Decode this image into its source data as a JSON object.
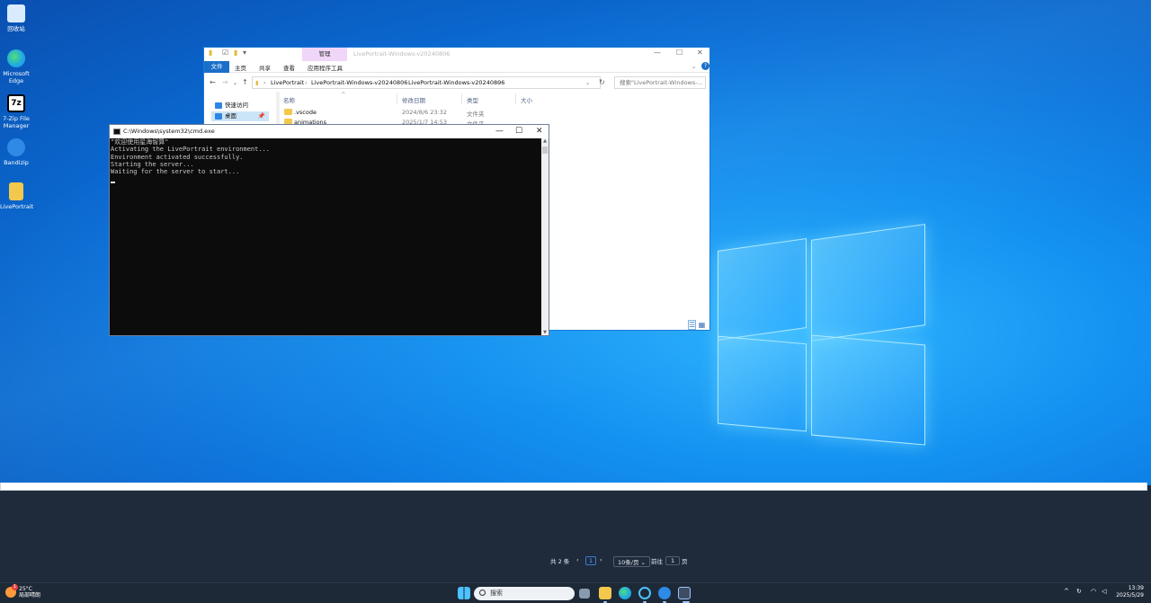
{
  "desktop": {
    "icons": [
      {
        "label": "回收站",
        "color": "#d9ecff"
      },
      {
        "label": "Microsoft Edge",
        "color": "#1fa6e6"
      },
      {
        "label": "7-Zip File Manager",
        "color": "#ffffff"
      },
      {
        "label": "Bandizip",
        "color": "#2e8ae6"
      },
      {
        "label": "LivePortrait",
        "color": "#f2c94c"
      }
    ]
  },
  "explorer": {
    "title": "LivePortrait-Windows-v20240806",
    "context_tab": "管理",
    "ribbon": {
      "file": "文件",
      "home": "主页",
      "share": "共享",
      "view": "查看",
      "app_tools": "应用程序工具"
    },
    "breadcrumb": [
      "LivePortrait",
      "LivePortrait-Windows-v20240806",
      "LivePortrait-Windows-v20240806"
    ],
    "search_placeholder": "搜索\"LivePortrait-Windows-...",
    "sidebar": [
      {
        "label": "快速访问"
      },
      {
        "label": "桌面"
      }
    ],
    "columns": {
      "name": "名称",
      "modified": "修改日期",
      "type": "类型",
      "size": "大小"
    },
    "rows": [
      {
        "name": ".vscode",
        "modified": "2024/8/6 23:32",
        "type": "文件夹"
      },
      {
        "name": "animations",
        "modified": "2025/1/7 14:53",
        "type": "文件夹"
      }
    ]
  },
  "cmd": {
    "title": "C:\\Windows\\system32\\cmd.exe",
    "lines": [
      "\"欢迎使用星海智算\"",
      "Activating the LivePortrait environment...",
      "Environment activated successfully.",
      "Starting the server...",
      "Waiting for the server to start..."
    ]
  },
  "pager": {
    "total": "共 2 条",
    "prev": "‹",
    "current": "1",
    "next": "›",
    "page_size": "10条/页",
    "goto_label": "前往",
    "goto_value": "1",
    "page_suffix": "页"
  },
  "taskbar": {
    "weather_temp": "25°C",
    "weather_desc": "局部晴朗",
    "weather_badge": "1",
    "search_label": "搜索",
    "time": "13:39",
    "date": "2025/5/29"
  }
}
